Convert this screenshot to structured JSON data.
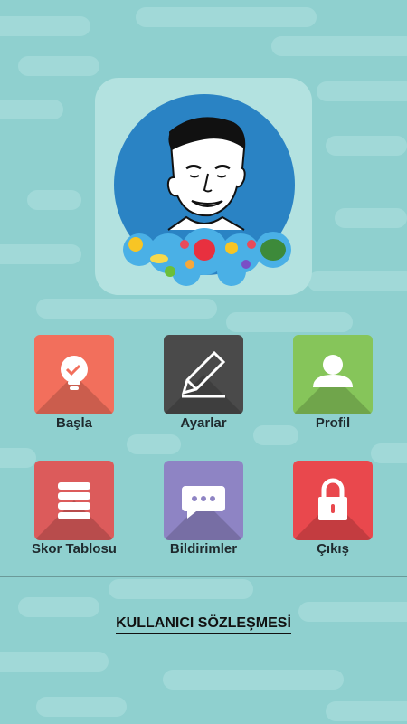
{
  "menu": {
    "start": {
      "label": "Başla",
      "color": "#f26f5c",
      "icon": "lightbulb-icon"
    },
    "settings": {
      "label": "Ayarlar",
      "color": "#4a4a4a",
      "icon": "pencil-icon"
    },
    "profile": {
      "label": "Profil",
      "color": "#86c55a",
      "icon": "user-icon"
    },
    "scoreboard": {
      "label": "Skor Tablosu",
      "color": "#dc5b5b",
      "icon": "list-icon"
    },
    "notifications": {
      "label": "Bildirimler",
      "color": "#8e84c4",
      "icon": "chat-bubble-icon"
    },
    "exit": {
      "label": "Çıkış",
      "color": "#e9484d",
      "icon": "lock-icon"
    }
  },
  "footer": {
    "agreement_label": "KULLANICI SÖZLEŞMESİ"
  },
  "colors": {
    "background": "#8fd0cf",
    "logo_circle": "#2a83c4"
  }
}
